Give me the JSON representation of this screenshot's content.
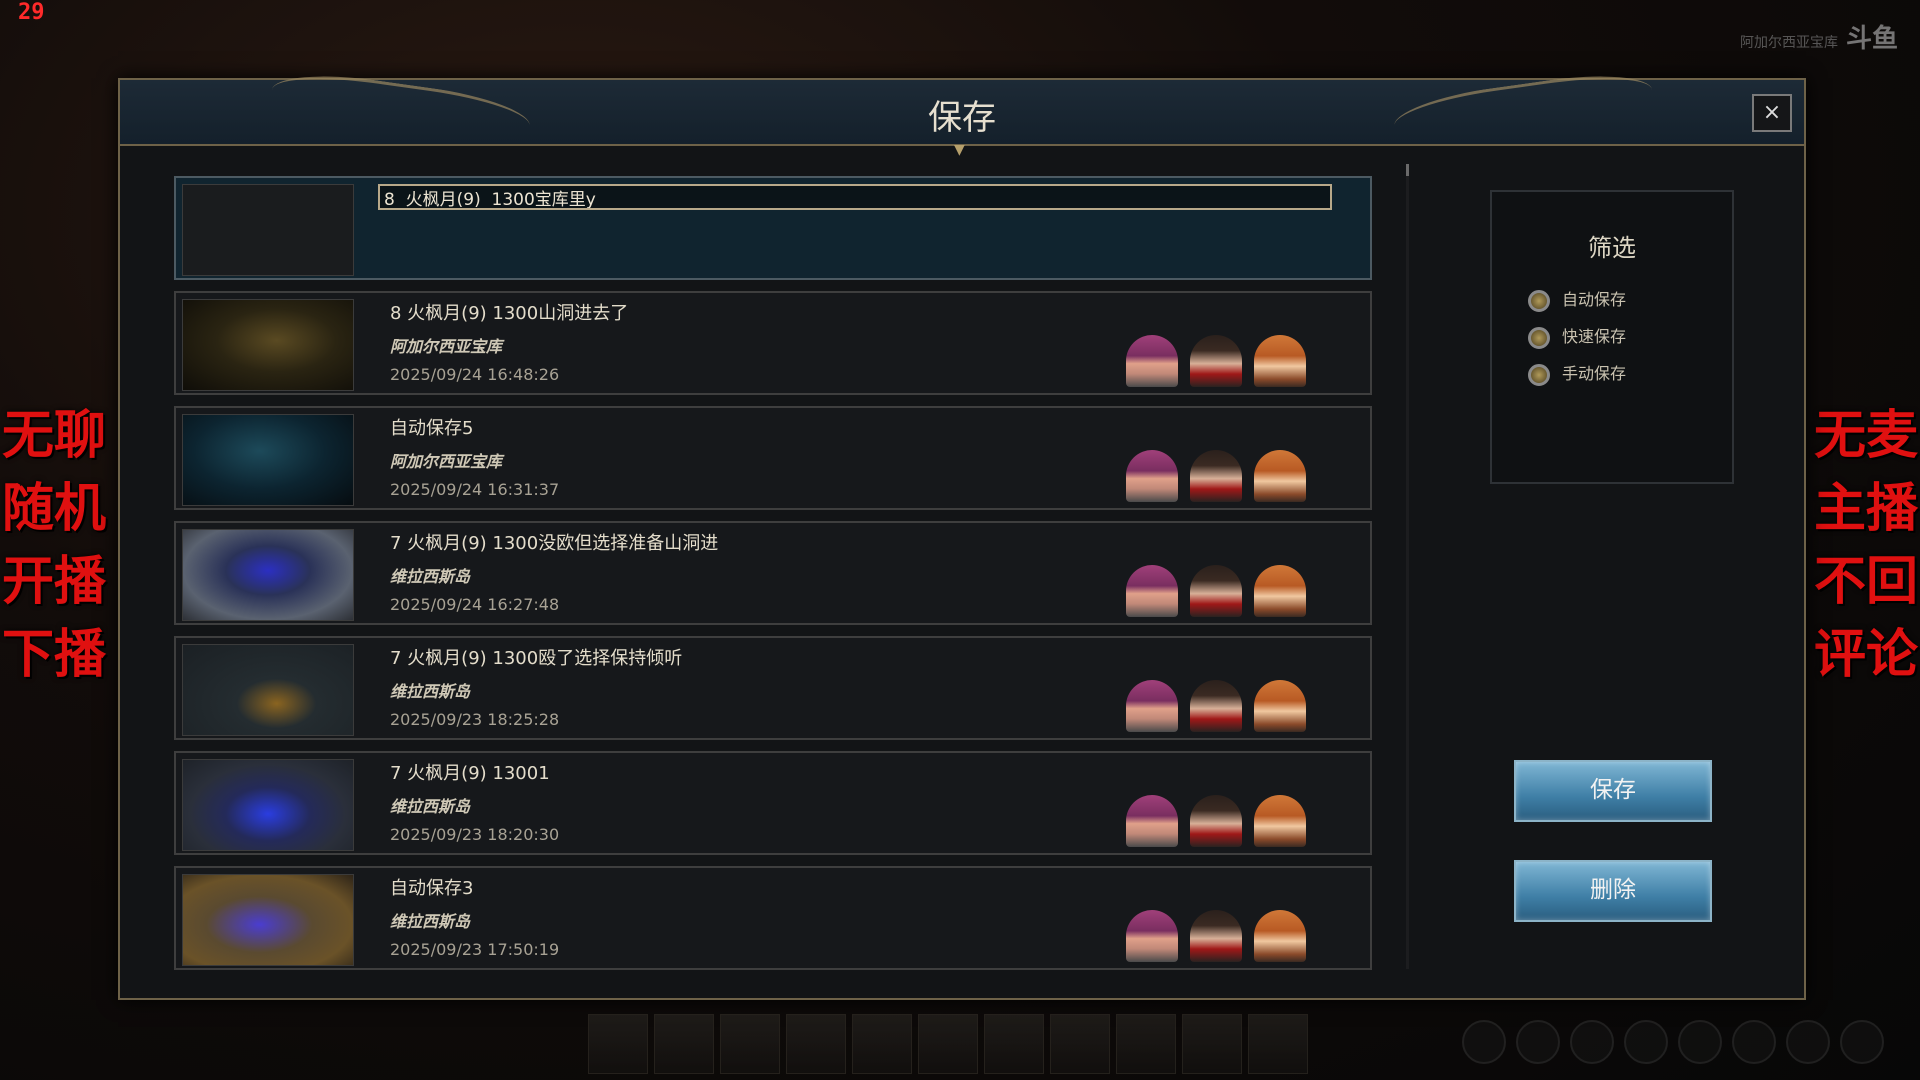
{
  "overlay": {
    "fps": "29",
    "logo_text": "阿加尔西亚宝库",
    "logo_brand": "斗鱼",
    "left_text": [
      "无聊",
      "随机",
      "开播",
      "下播"
    ],
    "right_text": [
      "无麦",
      "主播",
      "不回",
      "评论"
    ]
  },
  "dialog": {
    "title": "保存",
    "close_label": "×"
  },
  "new_save": {
    "input_value": "8  火枫月(9)  1300宝库里y"
  },
  "saves": [
    {
      "name": "8  火枫月(9)  1300山洞进去了",
      "location": "阿加尔西亚宝库",
      "timestamp": "2025/09/24 16:48:26"
    },
    {
      "name": "自动保存5",
      "location": "阿加尔西亚宝库",
      "timestamp": "2025/09/24 16:31:37"
    },
    {
      "name": "7  火枫月(9)  1300没欧但选择准备山洞进",
      "location": "维拉西斯岛",
      "timestamp": "2025/09/24 16:27:48"
    },
    {
      "name": "7  火枫月(9)  1300殴了选择保持倾听",
      "location": "维拉西斯岛",
      "timestamp": "2025/09/23 18:25:28"
    },
    {
      "name": "7  火枫月(9)  13001",
      "location": "维拉西斯岛",
      "timestamp": "2025/09/23 18:20:30"
    },
    {
      "name": "自动保存3",
      "location": "维拉西斯岛",
      "timestamp": "2025/09/23 17:50:19"
    }
  ],
  "filter": {
    "title": "筛选",
    "options": [
      "自动保存",
      "快速保存",
      "手动保存"
    ]
  },
  "buttons": {
    "save": "保存",
    "delete": "删除"
  }
}
